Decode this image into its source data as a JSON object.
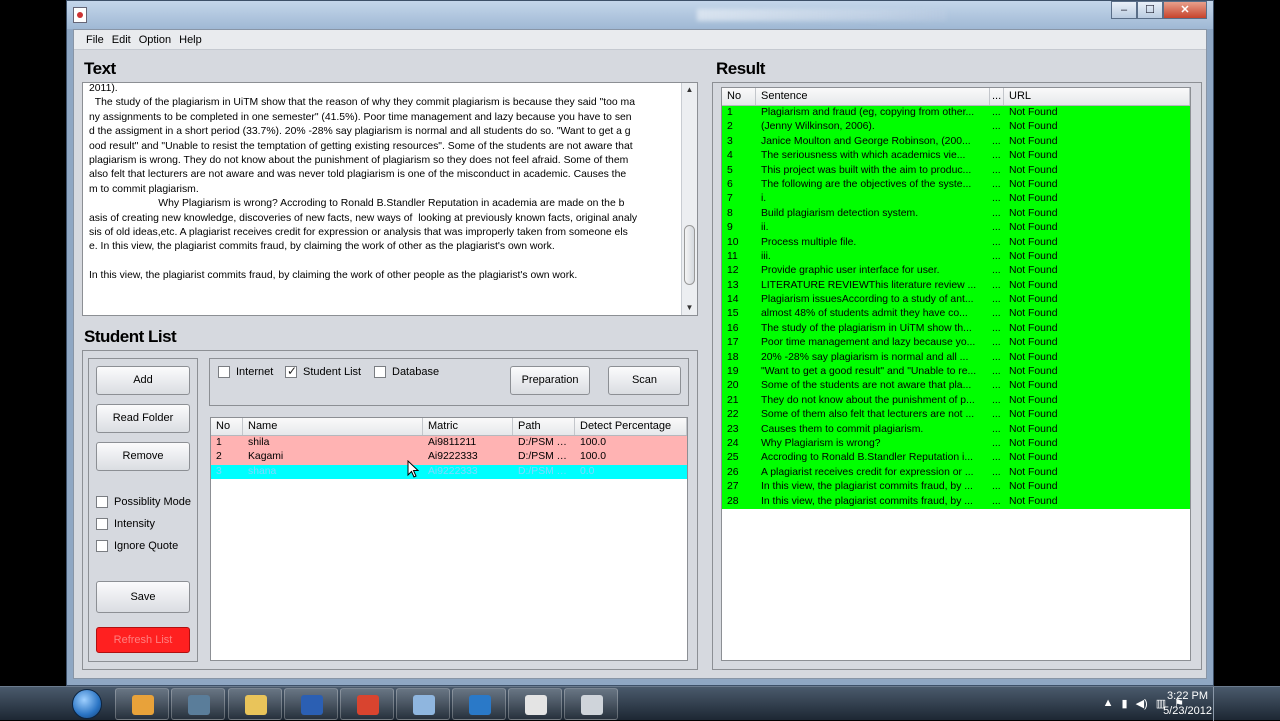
{
  "window": {
    "title_hidden": ""
  },
  "menu": [
    "File",
    "Edit",
    "Option",
    "Help"
  ],
  "sections": {
    "text": "Text",
    "result": "Result",
    "student_list": "Student List"
  },
  "text_area": {
    "lines": [
      "2011).",
      "  The study of the plagiarism in UiTM show that the reason of why they commit plagiarism is because they said \"too ma",
      "ny assignments to be completed in one semester\" (41.5%). Poor time management and lazy because you have to sen",
      "d the assigment in a short period (33.7%). 20% -28% say plagiarism is normal and all students do so. \"Want to get a g",
      "ood result\" and \"Unable to resist the temptation of getting existing resources\". Some of the students are not aware that",
      "plagiarism is wrong. They do not know about the punishment of plagiarism so they does not feel afraid. Some of them",
      "also felt that lecturers are not aware and was never told plagiarism is one of the misconduct in academic. Causes the",
      "m to commit plagiarism.",
      "                        Why Plagiarism is wrong? Accroding to Ronald B.Standler Reputation in academia are made on the b",
      "asis of creating new knowledge, discoveries of new facts, new ways of  looking at previously known facts, original analy",
      "sis of old ideas,etc. A plagiarist receives credit for expression or analysis that was improperly taken from someone els",
      "e. In this view, the plagiarist commits fraud, by claiming the work of other as the plagiarist's own work.",
      "",
      "In this view, the plagiarist commits fraud, by claiming the work of other people as the plagiarist's own work."
    ]
  },
  "left_buttons": {
    "add": "Add",
    "read_folder": "Read Folder",
    "remove": "Remove",
    "save": "Save",
    "refresh": "Refresh List"
  },
  "options": [
    {
      "label": "Possiblity Mode",
      "checked": false
    },
    {
      "label": "Intensity",
      "checked": false
    },
    {
      "label": "Ignore Quote",
      "checked": false
    }
  ],
  "sources": [
    {
      "label": "Internet",
      "checked": false
    },
    {
      "label": "Student List",
      "checked": true
    },
    {
      "label": "Database",
      "checked": false
    }
  ],
  "actions": {
    "preparation": "Preparation",
    "scan": "Scan"
  },
  "students": {
    "headers": [
      "No",
      "Name",
      "Matric",
      "Path",
      "Detect Percentage"
    ],
    "rows": [
      [
        "1",
        "shila",
        "Ai9811211",
        "D:/PSM T...",
        "100.0"
      ],
      [
        "2",
        "Kagami",
        "Ai9222333",
        "D:/PSM T...",
        "100.0"
      ],
      [
        "3",
        "shana",
        "Ai9222333",
        "D:/PSM T...",
        "0.0"
      ]
    ],
    "row_colors": [
      "#ffb3b3",
      "#ffb3b3",
      "#00ffff"
    ]
  },
  "results": {
    "headers": [
      "No",
      "Sentence",
      "...",
      "URL"
    ],
    "row_color": "#00ff00",
    "rows": [
      [
        "1",
        "Plagiarism and fraud (eg, copying from other...",
        "...",
        "Not Found"
      ],
      [
        "2",
        "(Jenny Wilkinson, 2006).",
        "...",
        "Not Found"
      ],
      [
        "3",
        "Janice Moulton and George Robinson, (200...",
        "...",
        "Not Found"
      ],
      [
        "4",
        "The seriousness with which academics vie...",
        "...",
        "Not Found"
      ],
      [
        "5",
        "This project was built with the aim to produc...",
        "...",
        "Not Found"
      ],
      [
        "6",
        "The following are the objectives of the syste...",
        "...",
        "Not Found"
      ],
      [
        "7",
        "i.",
        "...",
        "Not Found"
      ],
      [
        "8",
        "Build plagiarism detection system.",
        "...",
        "Not Found"
      ],
      [
        "9",
        "ii.",
        "...",
        "Not Found"
      ],
      [
        "10",
        "Process multiple file.",
        "...",
        "Not Found"
      ],
      [
        "11",
        "iii.",
        "...",
        "Not Found"
      ],
      [
        "12",
        "Provide graphic user interface for user.",
        "...",
        "Not Found"
      ],
      [
        "13",
        "LITERATURE REVIEWThis literature review ...",
        "...",
        "Not Found"
      ],
      [
        "14",
        "Plagiarism issuesAccording to a study of ant...",
        "...",
        "Not Found"
      ],
      [
        "15",
        "almost 48% of students admit they have co...",
        "...",
        "Not Found"
      ],
      [
        "16",
        "The study of the plagiarism in UiTM show th...",
        "...",
        "Not Found"
      ],
      [
        "17",
        "Poor time management and lazy because yo...",
        "...",
        "Not Found"
      ],
      [
        "18",
        "20% -28% say plagiarism is normal and all ...",
        "...",
        "Not Found"
      ],
      [
        "19",
        "\"Want to get a good result\" and \"Unable to re...",
        "...",
        "Not Found"
      ],
      [
        "20",
        "Some of the students are not aware that pla...",
        "...",
        "Not Found"
      ],
      [
        "21",
        "They do not know about the punishment of p...",
        "...",
        "Not Found"
      ],
      [
        "22",
        "Some of them also felt that lecturers are not ...",
        "...",
        "Not Found"
      ],
      [
        "23",
        "Causes them to commit plagiarism.",
        "...",
        "Not Found"
      ],
      [
        "24",
        "Why Plagiarism is wrong?",
        "...",
        "Not Found"
      ],
      [
        "25",
        "Accroding to Ronald B.Standler Reputation i...",
        "...",
        "Not Found"
      ],
      [
        "26",
        "A plagiarist receives credit for expression or ...",
        "...",
        "Not Found"
      ],
      [
        "27",
        "In this view, the plagiarist commits fraud, by ...",
        "...",
        "Not Found"
      ],
      [
        "28",
        "In this view, the plagiarist commits fraud, by ...",
        "...",
        "Not Found"
      ]
    ]
  },
  "taskbar": {
    "clock_time": "3:22 PM",
    "clock_date": "5/23/2012",
    "apps": [
      {
        "name": "media-player-icon",
        "color": "#e8a23a"
      },
      {
        "name": "browser-icon",
        "color": "#5a7d9a"
      },
      {
        "name": "explorer-icon",
        "color": "#e9c45a"
      },
      {
        "name": "word-icon",
        "color": "#2b5fb3"
      },
      {
        "name": "chrome-icon",
        "color": "#d9442f"
      },
      {
        "name": "virtualbox-icon",
        "color": "#8fb6df"
      },
      {
        "name": "download-icon",
        "color": "#2a79c8"
      },
      {
        "name": "java-icon",
        "color": "#e4e4e4"
      },
      {
        "name": "window-app-icon",
        "color": "#cfd4da"
      }
    ]
  }
}
